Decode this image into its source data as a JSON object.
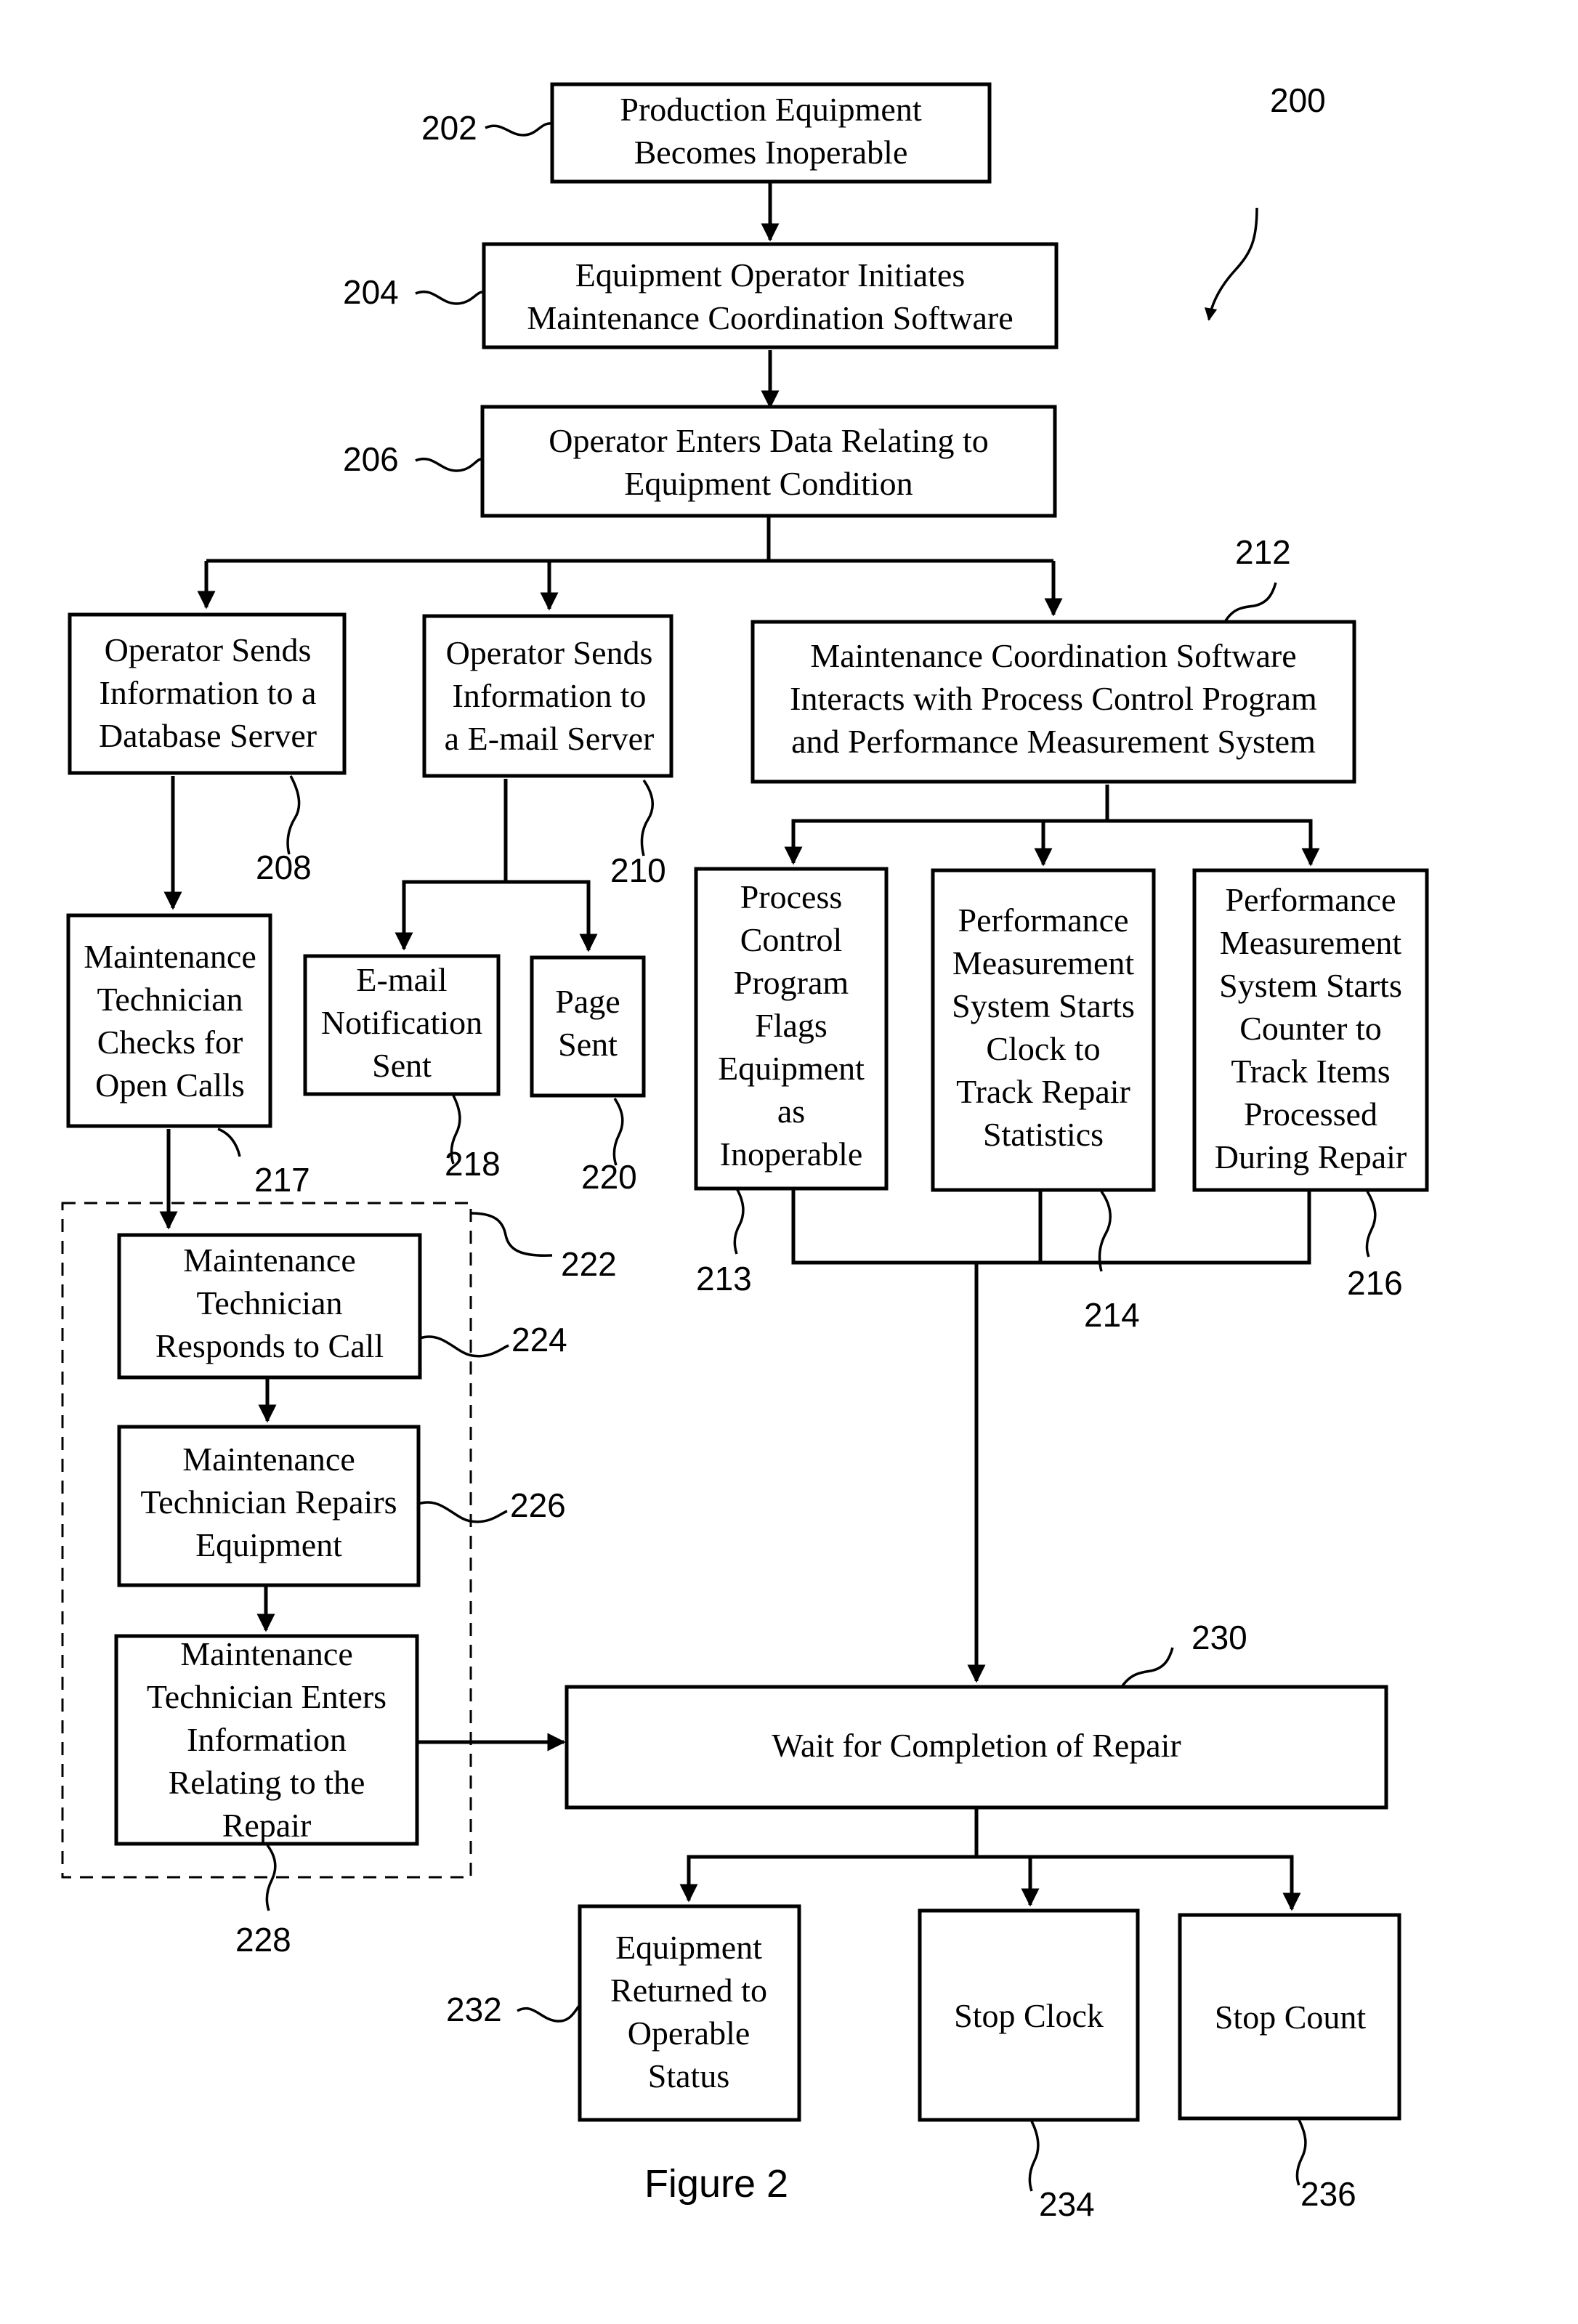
{
  "figure": {
    "caption": "Figure 2",
    "reference": "200"
  },
  "nodes": [
    {
      "id": "202",
      "ref": "202",
      "lines": [
        "Production Equipment",
        "Becomes Inoperable"
      ]
    },
    {
      "id": "204",
      "ref": "204",
      "lines": [
        "Equipment Operator Initiates",
        "Maintenance Coordination Software"
      ]
    },
    {
      "id": "206",
      "ref": "206",
      "lines": [
        "Operator Enters Data Relating to",
        "Equipment Condition"
      ]
    },
    {
      "id": "208",
      "ref": "208",
      "lines": [
        "Operator Sends",
        "Information to a",
        "Database Server"
      ]
    },
    {
      "id": "210",
      "ref": "210",
      "lines": [
        "Operator Sends",
        "Information to",
        "a E-mail Server"
      ]
    },
    {
      "id": "212",
      "ref": "212",
      "lines": [
        "Maintenance Coordination Software",
        "Interacts with Process Control Program",
        "and Performance Measurement System"
      ]
    },
    {
      "id": "217",
      "ref": "217",
      "lines": [
        "Maintenance",
        "Technician",
        "Checks for",
        "Open Calls"
      ]
    },
    {
      "id": "218",
      "ref": "218",
      "lines": [
        "E-mail",
        "Notification",
        "Sent"
      ]
    },
    {
      "id": "220",
      "ref": "220",
      "lines": [
        "Page",
        "Sent"
      ]
    },
    {
      "id": "213",
      "ref": "213",
      "lines": [
        "Process",
        "Control",
        "Program",
        "Flags",
        "Equipment",
        "as",
        "Inoperable"
      ]
    },
    {
      "id": "214",
      "ref": "214",
      "lines": [
        "Performance",
        "Measurement",
        "System Starts",
        "Clock to",
        "Track Repair",
        "Statistics"
      ]
    },
    {
      "id": "216",
      "ref": "216",
      "lines": [
        "Performance",
        "Measurement",
        "System Starts",
        "Counter to",
        "Track Items",
        "Processed",
        "During Repair"
      ]
    },
    {
      "id": "224",
      "ref": "224",
      "lines": [
        "Maintenance",
        "Technician",
        "Responds to Call"
      ]
    },
    {
      "id": "226",
      "ref": "226",
      "lines": [
        "Maintenance",
        "Technician Repairs",
        "Equipment"
      ]
    },
    {
      "id": "228",
      "ref": "228",
      "lines": [
        "Maintenance",
        "Technician Enters",
        "Information",
        "Relating to the",
        "Repair"
      ]
    },
    {
      "id": "230",
      "ref": "230",
      "lines": [
        "Wait for Completion of Repair"
      ]
    },
    {
      "id": "232",
      "ref": "232",
      "lines": [
        "Equipment",
        "Returned to",
        "Operable",
        "Status"
      ]
    },
    {
      "id": "234",
      "ref": "234",
      "lines": [
        "Stop Clock"
      ]
    },
    {
      "id": "236",
      "ref": "236",
      "lines": [
        "Stop Count"
      ]
    }
  ],
  "groups": [
    {
      "id": "222",
      "ref": "222",
      "contains": [
        "224",
        "226",
        "228"
      ]
    }
  ],
  "edges": [
    {
      "from": "202",
      "to": "204"
    },
    {
      "from": "204",
      "to": "206"
    },
    {
      "from": "206",
      "to": "208"
    },
    {
      "from": "206",
      "to": "210"
    },
    {
      "from": "206",
      "to": "212"
    },
    {
      "from": "208",
      "to": "217"
    },
    {
      "from": "210",
      "to": "218"
    },
    {
      "from": "210",
      "to": "220"
    },
    {
      "from": "212",
      "to": "213"
    },
    {
      "from": "212",
      "to": "214"
    },
    {
      "from": "212",
      "to": "216"
    },
    {
      "from": "217",
      "to": "224"
    },
    {
      "from": "224",
      "to": "226"
    },
    {
      "from": "226",
      "to": "228"
    },
    {
      "from": "228",
      "to": "230"
    },
    {
      "from": "213",
      "to": "230"
    },
    {
      "from": "214",
      "to": "230"
    },
    {
      "from": "216",
      "to": "230"
    },
    {
      "from": "230",
      "to": "232"
    },
    {
      "from": "230",
      "to": "234"
    },
    {
      "from": "230",
      "to": "236"
    }
  ]
}
